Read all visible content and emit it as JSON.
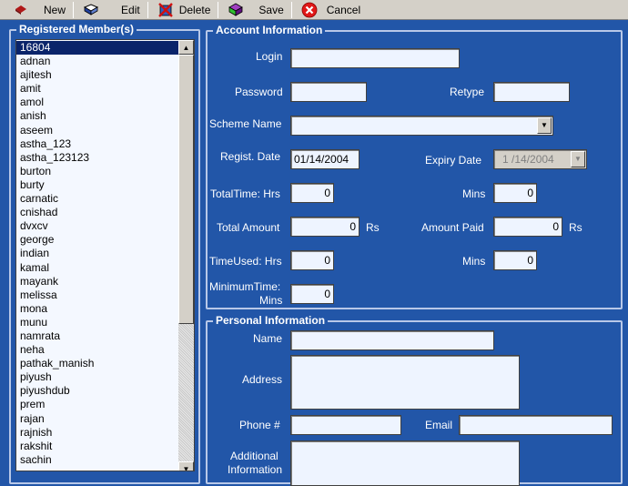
{
  "toolbar": {
    "new_label": "New",
    "edit_label": "Edit",
    "delete_label": "Delete",
    "save_label": "Save",
    "cancel_label": "Cancel"
  },
  "members": {
    "title": "Registered Member(s)",
    "items": [
      "16804",
      "adnan",
      "ajitesh",
      "amit",
      "amol",
      "anish",
      "aseem",
      "astha_123",
      "astha_123123",
      "burton",
      "burty",
      "carnatic",
      "cnishad",
      "dvxcv",
      "george",
      "indian",
      "kamal",
      "mayank",
      "melissa",
      "mona",
      "munu",
      "namrata",
      "neha",
      "pathak_manish",
      "piyush",
      "piyushdub",
      "prem",
      "rajan",
      "rajnish",
      "rakshit",
      "sachin"
    ],
    "selected": "16804"
  },
  "account": {
    "title": "Account Information",
    "login_label": "Login",
    "password_label": "Password",
    "retype_label": "Retype",
    "scheme_label": "Scheme Name",
    "regist_date_label": "Regist. Date",
    "regist_date_value": "01/14/2004",
    "expiry_date_label": "Expiry  Date",
    "expiry_date_value": "1 /14/2004",
    "total_time_label": "TotalTime: Hrs",
    "total_time_hrs": "0",
    "total_time_mins_label": "Mins",
    "total_time_mins": "0",
    "total_amount_label": "Total Amount",
    "total_amount_value": "0",
    "total_amount_unit": "Rs",
    "amount_paid_label": "Amount Paid",
    "amount_paid_value": "0",
    "amount_paid_unit": "Rs",
    "time_used_label": "TimeUsed: Hrs",
    "time_used_hrs": "0",
    "time_used_mins_label": "Mins",
    "time_used_mins": "0",
    "minimum_time_label_1": "MinimumTime:",
    "minimum_time_label_2": "Mins",
    "minimum_time_value": "0"
  },
  "personal": {
    "title": "Personal Information",
    "name_label": "Name",
    "address_label": "Address",
    "phone_label": "Phone #",
    "email_label": "Email",
    "additional_label_1": "Additional",
    "additional_label_2": "Information"
  },
  "icons": {
    "new": "new-record-icon",
    "edit": "edit-book-icon",
    "delete": "delete-icon",
    "save": "save-icon",
    "cancel": "cancel-icon"
  },
  "colors": {
    "form_background": "#2256a8",
    "selection": "#0a246a",
    "field_background": "#eef4ff"
  }
}
